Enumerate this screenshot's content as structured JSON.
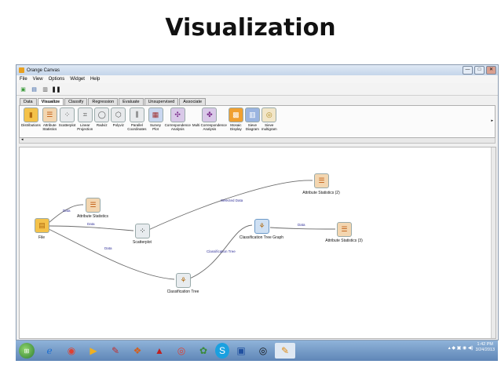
{
  "slide": {
    "title": "Visualization"
  },
  "window": {
    "title": "Orange Canvas",
    "controls": [
      "—",
      "□",
      "✕"
    ]
  },
  "menu": [
    "File",
    "View",
    "Options",
    "Widget",
    "Help"
  ],
  "tabs": [
    "Data",
    "Visualize",
    "Classify",
    "Regression",
    "Evaluate",
    "Unsupervised",
    "Associate"
  ],
  "active_tab": "Visualize",
  "widgets": [
    {
      "label": "Distributions",
      "icon": "bar-chart-icon"
    },
    {
      "label": "Attribute\nStatistics",
      "icon": "boxplot-icon"
    },
    {
      "label": "Scatterplot",
      "icon": "scatterplot-icon"
    },
    {
      "label": "Linear\nProjection",
      "icon": "projection-icon"
    },
    {
      "label": "Radviz",
      "icon": "radviz-icon"
    },
    {
      "label": "Polyviz",
      "icon": "polyviz-icon"
    },
    {
      "label": "Parallel\nCoordinates",
      "icon": "parallel-coordinates-icon"
    },
    {
      "label": "Survey\nPlot",
      "icon": "survey-plot-icon"
    },
    {
      "label": "Correspondence\nAnalysis",
      "icon": "correspondence-icon"
    },
    {
      "label": "Multi Correspondence\nAnalysis",
      "icon": "multi-correspondence-icon"
    },
    {
      "label": "Mosaic\nDisplay",
      "icon": "mosaic-icon"
    },
    {
      "label": "Sieve\nDiagram",
      "icon": "sieve-icon"
    },
    {
      "label": "Sieve\nmultigram",
      "icon": "sieve-multigram-icon"
    }
  ],
  "nodes": {
    "file": "File",
    "attr_stats": "Attribute Statistics",
    "scatterplot": "Scatterplot",
    "attr_stats_2": "Attribute Statistics (2)",
    "tree_graph": "Classification Tree Graph",
    "attr_stats_3": "Attribute Statistics (3)",
    "tree": "Classification Tree"
  },
  "links": {
    "file_to_stats": "Data",
    "file_to_scatter": "Data",
    "file_to_tree": "Data",
    "scatter_to_stats2": "Selected Data",
    "tree_to_graph": "Classification Tree",
    "graph_to_stats3": "Data"
  },
  "taskbar": {
    "time": "1:42 PM",
    "date": "3/24/2013"
  },
  "colors": {
    "link": "#6b6b6b",
    "link_label": "#33339a",
    "taskbar": "#6f95c4"
  }
}
